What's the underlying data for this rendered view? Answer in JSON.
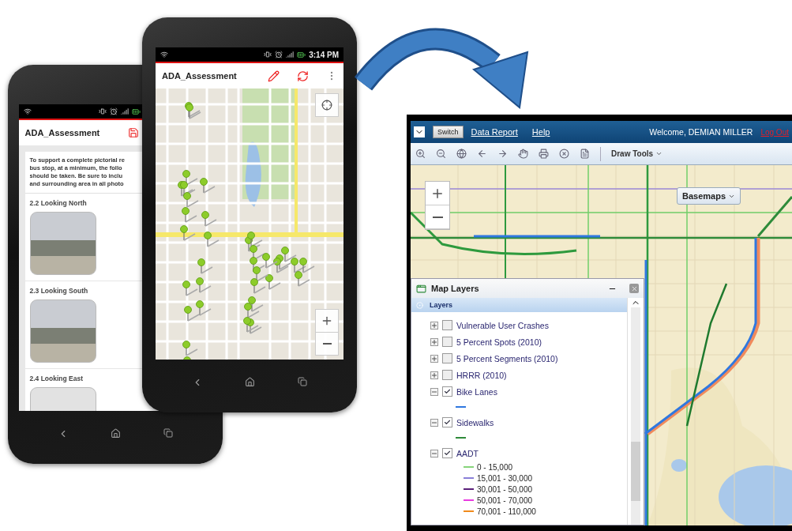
{
  "back_phone": {
    "app_bar": {
      "title": "ADA_Assessment"
    },
    "intro_lines": [
      "To support a complete pictorial re",
      "bus stop, at a minimum, the follo",
      "should be taken.  Be sure to inclu",
      "and surrounding area in all photo"
    ],
    "sections": [
      {
        "heading": "2.2 Looking North",
        "kind": "photo"
      },
      {
        "heading": "2.3 Looking South",
        "kind": "photo"
      },
      {
        "heading": "2.4 Looking East",
        "kind": "blank"
      }
    ]
  },
  "front_phone": {
    "status_bar": {
      "time": "3:14 PM"
    },
    "app_bar": {
      "title": "ADA_Assessment"
    }
  },
  "desktop": {
    "top_bar": {
      "switch": "Switch",
      "links": [
        "Data Report",
        "Help"
      ],
      "welcome": "Welcome, DEMIAN MILLER",
      "logout": "Log Out"
    },
    "toolbar": {
      "draw_tools": "Draw Tools"
    },
    "map": {
      "basemaps": "Basemaps"
    },
    "layers_panel": {
      "title": "Map Layers",
      "root": "Layers",
      "items": [
        {
          "label": "Vulnerable User Crashes",
          "checked": false,
          "expanded": false
        },
        {
          "label": "5 Percent Spots (2010)",
          "checked": false,
          "expanded": false
        },
        {
          "label": "5 Percent Segments (2010)",
          "checked": false,
          "expanded": false
        },
        {
          "label": "HRRR (2010)",
          "checked": false,
          "expanded": false
        },
        {
          "label": "Bike Lanes",
          "checked": true,
          "expanded": true,
          "legend": [
            {
              "color": "#2f78e0"
            }
          ]
        },
        {
          "label": "Sidewalks",
          "checked": true,
          "expanded": true,
          "legend": [
            {
              "color": "#2e8b3a"
            }
          ]
        },
        {
          "label": "AADT",
          "checked": true,
          "expanded": true,
          "legend": [
            {
              "label": "0 - 15,000",
              "color": "#86d47a"
            },
            {
              "label": "15,001 - 30,000",
              "color": "#8a7fd8"
            },
            {
              "label": "30,001 - 50,000",
              "color": "#5a1f7a"
            },
            {
              "label": "50,001 - 70,000",
              "color": "#e83be0"
            },
            {
              "label": "70,001 - 110,000",
              "color": "#f08a1c"
            }
          ]
        }
      ]
    }
  }
}
